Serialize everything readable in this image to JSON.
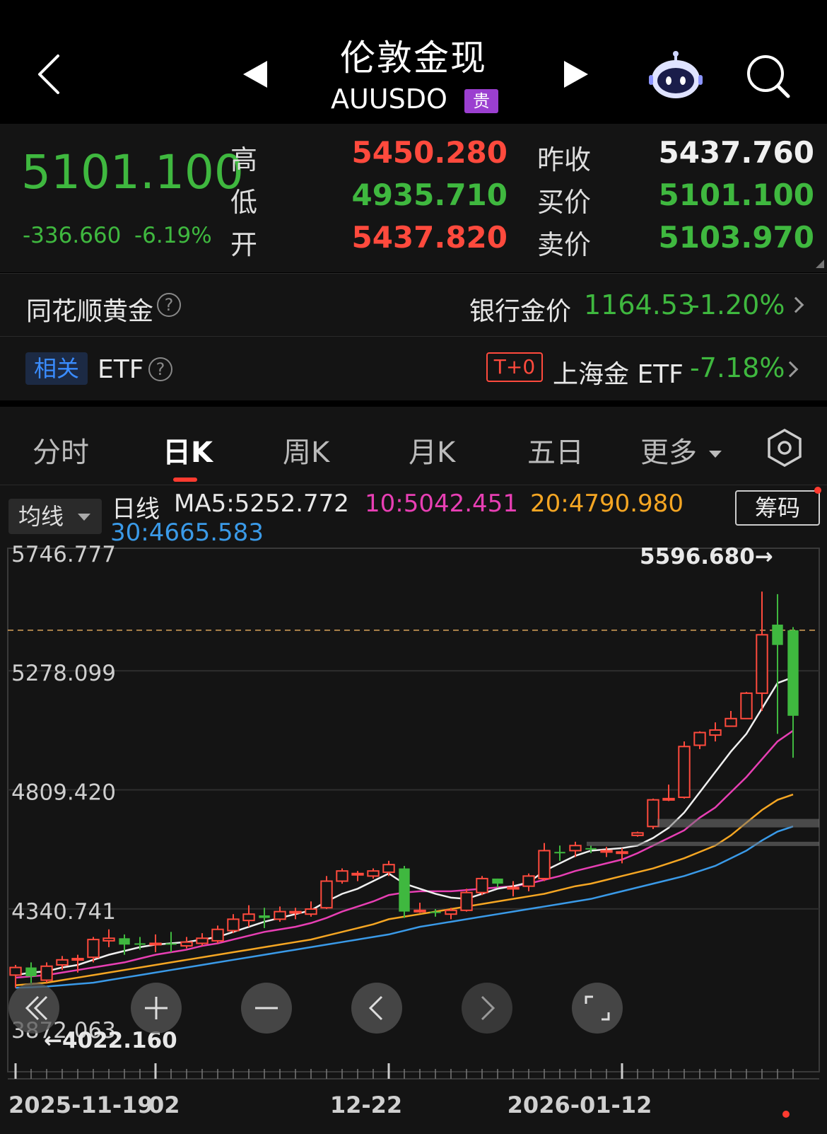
{
  "header": {
    "title": "伦敦金现",
    "code": "AUUSDO",
    "tag": "贵"
  },
  "quote": {
    "price": "5101.100",
    "change": "-336.660",
    "change_pct": "-6.19%",
    "labels": {
      "high": "高",
      "low": "低",
      "open": "开",
      "prev_close": "昨收",
      "bid": "买价",
      "ask": "卖价"
    },
    "high": "5450.280",
    "low": "4935.710",
    "open": "5437.820",
    "prev_close": "5437.760",
    "bid": "5101.100",
    "ask": "5103.970"
  },
  "gold_row": {
    "label": "同花顺黄金",
    "help": "?",
    "bank_label": "银行金价",
    "bank_price": "1164.53",
    "bank_pct": "-1.20%"
  },
  "etf_row": {
    "tag": "相关",
    "label": "ETF",
    "help": "?",
    "t0_tag": "T+0",
    "etf_name": "上海金 ETF",
    "etf_pct": "-7.18%"
  },
  "tabs": [
    "分时",
    "日K",
    "周K",
    "月K",
    "五日",
    "更多"
  ],
  "active_tab": "日K",
  "indicator": {
    "select": "均线",
    "line_label": "日线",
    "ma5": "MA5:5252.772",
    "ma10": "10:5042.451",
    "ma20": "20:4790.980",
    "ma30": "30:4665.583",
    "chouma": "筹码"
  },
  "colors": {
    "up": "#ff4a3d",
    "down": "#3fb83f",
    "ma5": "#f0f0f0",
    "ma10": "#e83fb4",
    "ma20": "#f5a623",
    "ma30": "#3a9ae8"
  },
  "chart_data": {
    "type": "candlestick",
    "y_ticks": [
      "5746.777",
      "5278.099",
      "4809.420",
      "4340.741",
      "3872.063"
    ],
    "ylim": [
      3872.063,
      5746.777
    ],
    "x_tick_labels": [
      "2025-11-19",
      "02",
      "12-22",
      "2026-01-12"
    ],
    "max_annotation": "5596.680→",
    "min_annotation": "←4022.160",
    "prev_close": 5437.76,
    "candles": [
      [
        4080,
        4110,
        4030,
        4120
      ],
      [
        4110,
        4075,
        4040,
        4130
      ],
      [
        4060,
        4115,
        4050,
        4130
      ],
      [
        4120,
        4140,
        4100,
        4155
      ],
      [
        4140,
        4145,
        4090,
        4160
      ],
      [
        4150,
        4220,
        4130,
        4230
      ],
      [
        4215,
        4225,
        4190,
        4260
      ],
      [
        4225,
        4200,
        4160,
        4240
      ],
      [
        4205,
        4200,
        4180,
        4230
      ],
      [
        4200,
        4205,
        4170,
        4240
      ],
      [
        4205,
        4200,
        4170,
        4250
      ],
      [
        4195,
        4210,
        4185,
        4230
      ],
      [
        4205,
        4225,
        4195,
        4245
      ],
      [
        4215,
        4260,
        4205,
        4275
      ],
      [
        4255,
        4300,
        4245,
        4320
      ],
      [
        4295,
        4320,
        4270,
        4355
      ],
      [
        4315,
        4305,
        4265,
        4345
      ],
      [
        4300,
        4330,
        4290,
        4350
      ],
      [
        4330,
        4330,
        4300,
        4345
      ],
      [
        4320,
        4340,
        4310,
        4370
      ],
      [
        4345,
        4450,
        4340,
        4470
      ],
      [
        4450,
        4490,
        4440,
        4500
      ],
      [
        4475,
        4480,
        4450,
        4490
      ],
      [
        4470,
        4490,
        4460,
        4500
      ],
      [
        4485,
        4515,
        4470,
        4530
      ],
      [
        4500,
        4330,
        4305,
        4510
      ],
      [
        4330,
        4335,
        4325,
        4365
      ],
      [
        4330,
        4325,
        4310,
        4340
      ],
      [
        4320,
        4335,
        4300,
        4345
      ],
      [
        4335,
        4405,
        4330,
        4420
      ],
      [
        4405,
        4460,
        4395,
        4470
      ],
      [
        4460,
        4440,
        4425,
        4460
      ],
      [
        4420,
        4425,
        4390,
        4450
      ],
      [
        4430,
        4470,
        4410,
        4480
      ],
      [
        4460,
        4570,
        4450,
        4600
      ],
      [
        4565,
        4560,
        4530,
        4590
      ],
      [
        4570,
        4590,
        4545,
        4605
      ],
      [
        4580,
        4575,
        4560,
        4590
      ],
      [
        4570,
        4570,
        4545,
        4585
      ],
      [
        4565,
        4565,
        4520,
        4580
      ],
      [
        4630,
        4640,
        4625,
        4645
      ],
      [
        4665,
        4770,
        4655,
        4775
      ],
      [
        4775,
        4775,
        4765,
        4830
      ],
      [
        4780,
        4980,
        4775,
        5000
      ],
      [
        4985,
        5035,
        4970,
        5040
      ],
      [
        5025,
        5045,
        5000,
        5075
      ],
      [
        5060,
        5090,
        5060,
        5120
      ],
      [
        5090,
        5190,
        5090,
        5195
      ],
      [
        5190,
        5420,
        5120,
        5590
      ],
      [
        5460,
        5380,
        5030,
        5580
      ],
      [
        5437.82,
        5101.1,
        4935.71,
        5450.28
      ]
    ],
    "ma5": [
      4080,
      4090,
      4095,
      4110,
      4120,
      4140,
      4160,
      4175,
      4190,
      4200,
      4205,
      4210,
      4220,
      4230,
      4250,
      4270,
      4290,
      4305,
      4320,
      4335,
      4370,
      4400,
      4420,
      4450,
      4480,
      4440,
      4420,
      4400,
      4385,
      4380,
      4400,
      4420,
      4430,
      4445,
      4490,
      4520,
      4550,
      4570,
      4575,
      4580,
      4590,
      4620,
      4660,
      4720,
      4800,
      4880,
      4960,
      5030,
      5130,
      5230,
      5252.772
    ],
    "ma10": [
      4070,
      4075,
      4080,
      4090,
      4100,
      4110,
      4120,
      4130,
      4145,
      4160,
      4170,
      4180,
      4195,
      4205,
      4220,
      4235,
      4250,
      4260,
      4270,
      4285,
      4305,
      4330,
      4350,
      4370,
      4395,
      4405,
      4410,
      4410,
      4410,
      4415,
      4420,
      4425,
      4430,
      4440,
      4455,
      4470,
      4490,
      4505,
      4520,
      4535,
      4560,
      4590,
      4620,
      4650,
      4700,
      4740,
      4800,
      4860,
      4930,
      5000,
      5042.451
    ],
    "ma20": [
      4040,
      4045,
      4050,
      4060,
      4070,
      4080,
      4090,
      4100,
      4110,
      4120,
      4130,
      4140,
      4150,
      4160,
      4170,
      4180,
      4190,
      4200,
      4210,
      4220,
      4235,
      4250,
      4265,
      4280,
      4300,
      4310,
      4320,
      4330,
      4340,
      4350,
      4360,
      4370,
      4380,
      4390,
      4400,
      4415,
      4430,
      4440,
      4455,
      4470,
      4485,
      4500,
      4520,
      4540,
      4565,
      4590,
      4630,
      4680,
      4730,
      4770,
      4790.98
    ],
    "ma30": [
      4030,
      4032,
      4035,
      4040,
      4045,
      4050,
      4060,
      4070,
      4080,
      4090,
      4100,
      4110,
      4120,
      4130,
      4140,
      4150,
      4160,
      4170,
      4180,
      4190,
      4200,
      4210,
      4220,
      4230,
      4240,
      4255,
      4270,
      4280,
      4290,
      4300,
      4310,
      4320,
      4330,
      4340,
      4350,
      4360,
      4370,
      4380,
      4395,
      4410,
      4425,
      4440,
      4455,
      4470,
      4490,
      4510,
      4540,
      4570,
      4610,
      4645,
      4665.583
    ]
  }
}
